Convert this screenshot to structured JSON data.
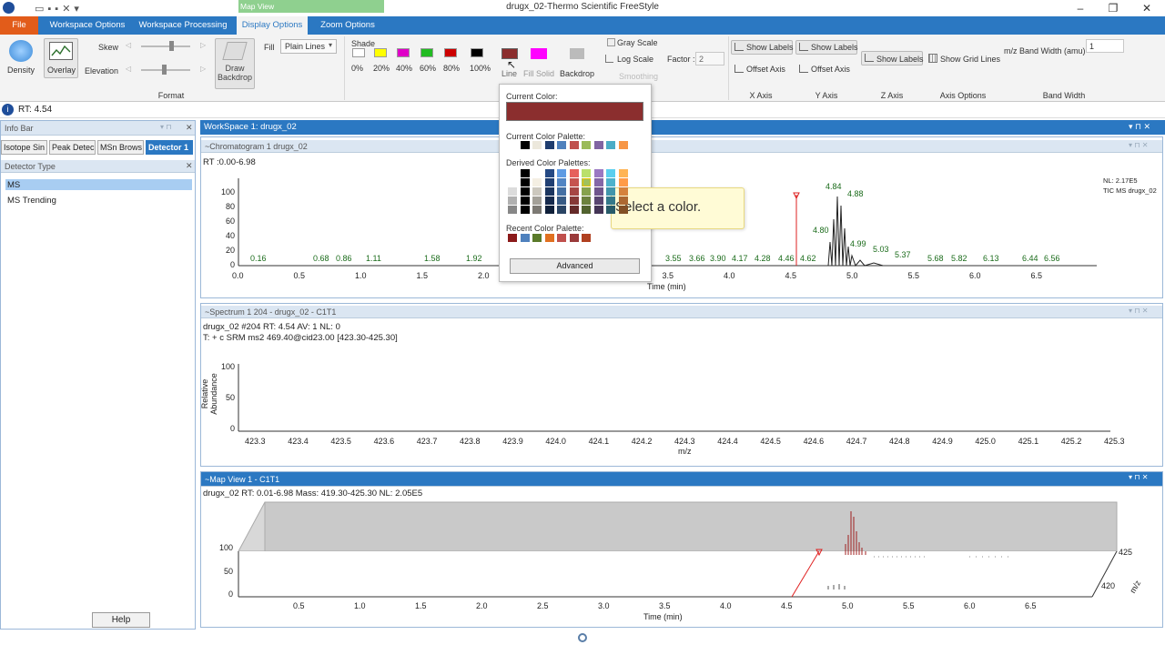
{
  "window": {
    "title": "drugx_02-Thermo Scientific FreeStyle",
    "context_tab": "Map View"
  },
  "tabs": [
    {
      "label": "File"
    },
    {
      "label": "Workspace Options"
    },
    {
      "label": "Workspace Processing"
    },
    {
      "label": "Display Options"
    },
    {
      "label": "Zoom Options"
    }
  ],
  "ribbon": {
    "density": "Density",
    "overlay": "Overlay",
    "skew": "Skew",
    "elevation": "Elevation",
    "draw_backdrop": "Draw Backdrop",
    "fill": "Fill",
    "fill_value": "Plain Lines",
    "shade": "Shade",
    "shade_levels": [
      "0%",
      "20%",
      "40%",
      "60%",
      "80%",
      "100%"
    ],
    "shade_colors": [
      "#ffffff",
      "#ffff00",
      "#e000c8",
      "#22bb22",
      "#cc0000",
      "#000000"
    ],
    "line": "Line",
    "fill_solid": "Fill Solid",
    "backdrop": "Backdrop",
    "gray_scale": "Gray Scale",
    "log_scale": "Log Scale",
    "smoothing": "Smoothing",
    "factor": "Factor :",
    "factor_value": "2",
    "show_labels_x": "Show Labels",
    "offset_axis_x": "Offset Axis",
    "show_labels_y": "Show Labels",
    "offset_axis_y": "Offset Axis",
    "show_labels_z": "Show Labels",
    "show_grid_lines": "Show Grid Lines",
    "band_width": "m/z Band Width (amu)",
    "band_width_value": "1",
    "groups": {
      "format": "Format",
      "x_axis": "X Axis",
      "y_axis": "Y Axis",
      "z_axis": "Z Axis",
      "axis_options": "Axis Options",
      "band_width": "Band Width"
    }
  },
  "rt_bar": "RT: 4.54",
  "left": {
    "info_bar": "Info Bar",
    "tabs": [
      "Isotope Sin",
      "Peak Detec",
      "MSn Brows",
      "Detector 1"
    ],
    "detector_type": "Detector Type",
    "items": [
      "MS",
      "MS Trending"
    ],
    "help": "Help"
  },
  "workspace": {
    "title": "WorkSpace 1: drugx_02"
  },
  "chromatogram": {
    "header": "~Chromatogram  1  drugx_02",
    "rt_range": "RT :0.00-6.98",
    "nl": "NL: 2.17E5",
    "tic": "TIC  MS  drugx_02",
    "y_ticks": [
      "100",
      "80",
      "60",
      "40",
      "20",
      "0"
    ],
    "x_ticks": [
      "0.0",
      "0.5",
      "1.0",
      "1.5",
      "2.0",
      "3.5",
      "4.0",
      "4.5",
      "5.0",
      "5.5",
      "6.0",
      "6.5"
    ],
    "xlabel": "Time (min)",
    "labels": [
      "0.16",
      "0.68",
      "0.86",
      "1.11",
      "1.58",
      "1.92",
      "3.55",
      "3.66",
      "3.90",
      "4.17",
      "4.28",
      "4.46",
      "4.62",
      "4.84",
      "4.88",
      "4.80",
      "4.99",
      "5.03",
      "5.37",
      "5.68",
      "5.82",
      "6.13",
      "6.44",
      "6.56"
    ]
  },
  "spectrum": {
    "header": "~Spectrum  1  204 - drugx_02 - C1T1",
    "info1": "drugx_02 #204  RT: 4.54  AV: 1  NL: 0",
    "info2": "T: + c SRM ms2 469.40@cid23.00 [423.30-425.30]",
    "ylabel": "Relative Abundance",
    "y_ticks": [
      "100",
      "50",
      "0"
    ],
    "x_ticks": [
      "423.3",
      "423.4",
      "423.5",
      "423.6",
      "423.7",
      "423.8",
      "423.9",
      "424.0",
      "424.1",
      "424.2",
      "424.3",
      "424.4",
      "424.5",
      "424.6",
      "424.7",
      "424.8",
      "424.9",
      "425.0",
      "425.1",
      "425.2",
      "425.3"
    ],
    "xlabel": "m/z"
  },
  "mapview": {
    "header": "~Map View  1  - C1T1",
    "info": "drugx_02   RT: 0.01-6.98   Mass: 419.30-425.30   NL: 2.05E5",
    "y_ticks": [
      "100",
      "50",
      "0"
    ],
    "x_ticks": [
      "0.5",
      "1.0",
      "1.5",
      "2.0",
      "2.5",
      "3.0",
      "3.5",
      "4.0",
      "4.5",
      "5.0",
      "5.5",
      "6.0",
      "6.5"
    ],
    "xlabel": "Time (min)",
    "z_ticks": [
      "425",
      "420"
    ],
    "zlabel": "m/z"
  },
  "color_popup": {
    "current_color": "Current Color:",
    "current_hex": "#8b2e2e",
    "current_palette": "Current Color Palette:",
    "palette": [
      "#ffffff",
      "#000000",
      "#ece8dc",
      "#1f3d6e",
      "#4f81bd",
      "#c0504d",
      "#9bbb59",
      "#8064a2",
      "#4bacc6",
      "#f79646"
    ],
    "derived": "Derived Color Palettes:",
    "recent": "Recent Color Palette:",
    "recent_colors": [
      "#8b1a1a",
      "#4f81bd",
      "#5a7a2a",
      "#e07020",
      "#c0504d",
      "#9a3a3a",
      "#b04020"
    ],
    "advanced": "Advanced",
    "tooltip": "Select a color."
  }
}
